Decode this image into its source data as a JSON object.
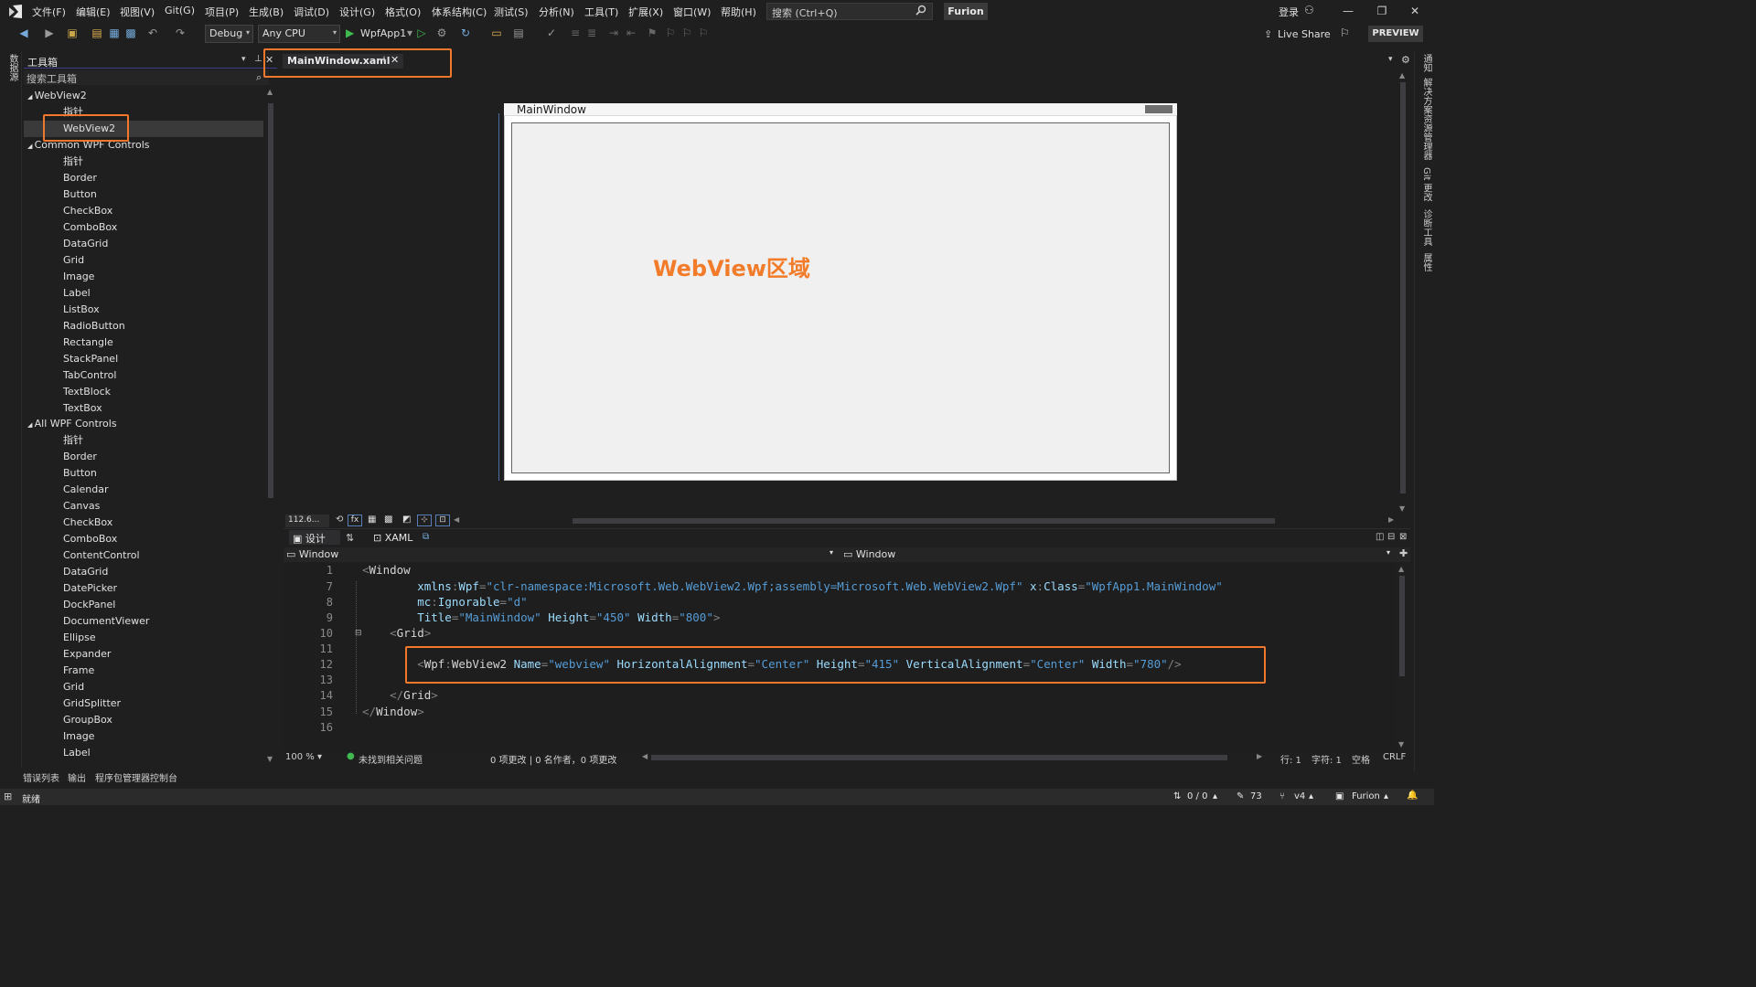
{
  "menubar": {
    "items": [
      "文件(F)",
      "编辑(E)",
      "视图(V)",
      "Git(G)",
      "项目(P)",
      "生成(B)",
      "调试(D)",
      "设计(G)",
      "格式(O)",
      "体系结构(C)",
      "测试(S)",
      "分析(N)",
      "工具(T)",
      "扩展(X)",
      "窗口(W)",
      "帮助(H)"
    ],
    "search_placeholder": "搜索 (Ctrl+Q)",
    "solution_name": "Furion",
    "login_label": "登录"
  },
  "toolbar": {
    "configuration": "Debug",
    "platform": "Any CPU",
    "startup_project": "WpfApp1",
    "live_share": "Live Share",
    "preview": "PREVIEW"
  },
  "left_rail": {
    "label": "数据源"
  },
  "toolbox": {
    "title": "工具箱",
    "search_placeholder": "搜索工具箱",
    "groups": [
      {
        "name": "WebView2",
        "items": [
          "指针",
          "WebView2"
        ]
      },
      {
        "name": "Common WPF Controls",
        "items": [
          "指针",
          "Border",
          "Button",
          "CheckBox",
          "ComboBox",
          "DataGrid",
          "Grid",
          "Image",
          "Label",
          "ListBox",
          "RadioButton",
          "Rectangle",
          "StackPanel",
          "TabControl",
          "TextBlock",
          "TextBox"
        ]
      },
      {
        "name": "All WPF Controls",
        "items": [
          "指针",
          "Border",
          "Button",
          "Calendar",
          "Canvas",
          "CheckBox",
          "ComboBox",
          "ContentControl",
          "DataGrid",
          "DatePicker",
          "DockPanel",
          "DocumentViewer",
          "Ellipse",
          "Expander",
          "Frame",
          "Grid",
          "GridSplitter",
          "GroupBox",
          "Image",
          "Label"
        ]
      }
    ],
    "selected_item": "WebView2"
  },
  "document_tab": {
    "label": "MainWindow.xaml"
  },
  "designer": {
    "window_title": "MainWindow",
    "webview_label": "WebView区域",
    "zoom": "112.6...",
    "design_tab": "设计",
    "xaml_tab": "XAML",
    "crumb_left": "Window",
    "crumb_right": "Window"
  },
  "code_lines": [
    {
      "n": "1",
      "segments": [
        {
          "t": "<",
          "c": "pun"
        },
        {
          "t": "Window",
          "c": "tag"
        }
      ]
    },
    {
      "n": "7",
      "segments": [
        {
          "t": "        xmlns",
          "c": "attr"
        },
        {
          "t": ":",
          "c": "pun"
        },
        {
          "t": "Wpf",
          "c": "attr"
        },
        {
          "t": "=",
          "c": "pun"
        },
        {
          "t": "\"clr-namespace:Microsoft.Web.WebView2.Wpf;assembly=Microsoft.Web.WebView2.Wpf\"",
          "c": "str"
        },
        {
          "t": " x",
          "c": "attr"
        },
        {
          "t": ":",
          "c": "pun"
        },
        {
          "t": "Class",
          "c": "attr"
        },
        {
          "t": "=",
          "c": "pun"
        },
        {
          "t": "\"WpfApp1.MainWindow\"",
          "c": "str"
        }
      ]
    },
    {
      "n": "8",
      "segments": [
        {
          "t": "        mc",
          "c": "attr"
        },
        {
          "t": ":",
          "c": "pun"
        },
        {
          "t": "Ignorable",
          "c": "attr"
        },
        {
          "t": "=",
          "c": "pun"
        },
        {
          "t": "\"d\"",
          "c": "str"
        }
      ]
    },
    {
      "n": "9",
      "segments": [
        {
          "t": "        Title",
          "c": "attr"
        },
        {
          "t": "=",
          "c": "pun"
        },
        {
          "t": "\"MainWindow\"",
          "c": "str"
        },
        {
          "t": " Height",
          "c": "attr"
        },
        {
          "t": "=",
          "c": "pun"
        },
        {
          "t": "\"450\"",
          "c": "str"
        },
        {
          "t": " Width",
          "c": "attr"
        },
        {
          "t": "=",
          "c": "pun"
        },
        {
          "t": "\"800\"",
          "c": "str"
        },
        {
          "t": ">",
          "c": "pun"
        }
      ]
    },
    {
      "n": "10",
      "segments": [
        {
          "t": "    ",
          "c": "tag"
        },
        {
          "t": "<",
          "c": "pun"
        },
        {
          "t": "Grid",
          "c": "tag"
        },
        {
          "t": ">",
          "c": "pun"
        }
      ]
    },
    {
      "n": "11",
      "segments": []
    },
    {
      "n": "12",
      "segments": [
        {
          "t": "        ",
          "c": "tag"
        },
        {
          "t": "<",
          "c": "pun"
        },
        {
          "t": "Wpf",
          "c": "tag"
        },
        {
          "t": ":",
          "c": "pun"
        },
        {
          "t": "WebView2",
          "c": "tag"
        },
        {
          "t": " Name",
          "c": "attr"
        },
        {
          "t": "=",
          "c": "pun"
        },
        {
          "t": "\"webview\"",
          "c": "str"
        },
        {
          "t": " HorizontalAlignment",
          "c": "attr"
        },
        {
          "t": "=",
          "c": "pun"
        },
        {
          "t": "\"Center\"",
          "c": "str"
        },
        {
          "t": " Height",
          "c": "attr"
        },
        {
          "t": "=",
          "c": "pun"
        },
        {
          "t": "\"415\"",
          "c": "str"
        },
        {
          "t": " VerticalAlignment",
          "c": "attr"
        },
        {
          "t": "=",
          "c": "pun"
        },
        {
          "t": "\"Center\"",
          "c": "str"
        },
        {
          "t": " Width",
          "c": "attr"
        },
        {
          "t": "=",
          "c": "pun"
        },
        {
          "t": "\"780\"",
          "c": "str"
        },
        {
          "t": "/>",
          "c": "pun"
        }
      ]
    },
    {
      "n": "13",
      "segments": []
    },
    {
      "n": "14",
      "segments": [
        {
          "t": "    ",
          "c": "tag"
        },
        {
          "t": "</",
          "c": "pun"
        },
        {
          "t": "Grid",
          "c": "tag"
        },
        {
          "t": ">",
          "c": "pun"
        }
      ]
    },
    {
      "n": "15",
      "segments": [
        {
          "t": "</",
          "c": "pun"
        },
        {
          "t": "Window",
          "c": "tag"
        },
        {
          "t": ">",
          "c": "pun"
        }
      ]
    },
    {
      "n": "16",
      "segments": []
    }
  ],
  "editor_status": {
    "zoom": "100 %",
    "issues": "未找到相关问题",
    "changes": "0 项更改 | 0 名作者，0 项更改",
    "line": "行: 1",
    "char": "字符: 1",
    "space": "空格",
    "eol": "CRLF"
  },
  "bottom_tabs": [
    "错误列表",
    "输出",
    "程序包管理器控制台"
  ],
  "statusbar": {
    "ready": "就绪",
    "sync": "0 / 0",
    "edits": "73",
    "branch": "v4",
    "repo": "Furion"
  },
  "right_rail": [
    "通知",
    "解决方案资源管理器",
    "Git 更改",
    "诊断工具",
    "属性"
  ],
  "colors": {
    "accent_orange": "#f0772b",
    "background": "#1f1f1f",
    "string": "#569cd6",
    "attribute": "#9cdcfe"
  }
}
